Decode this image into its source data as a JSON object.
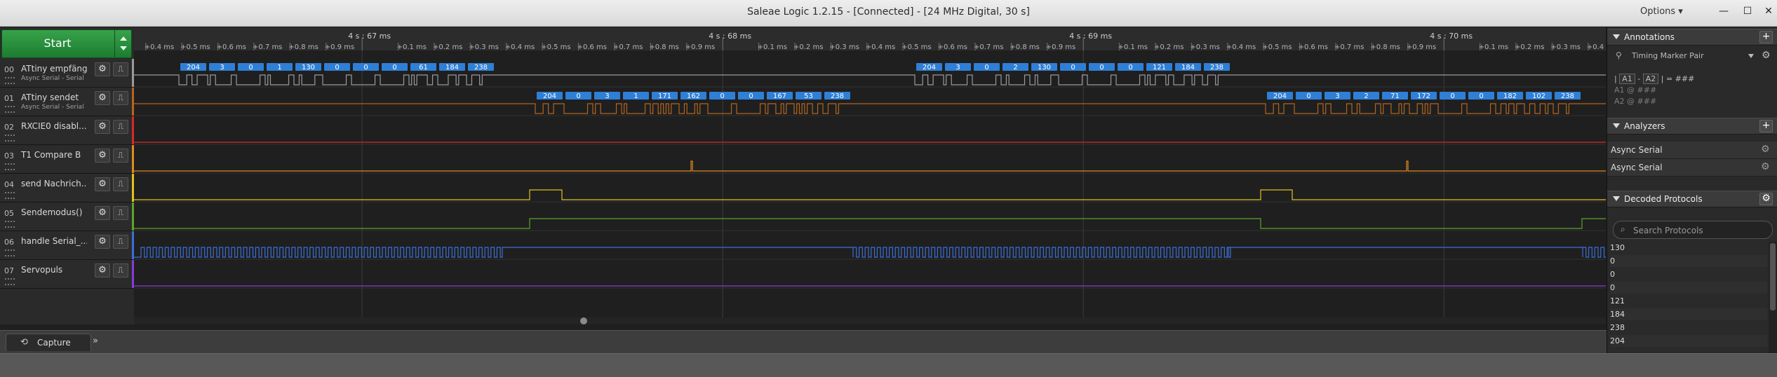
{
  "window": {
    "title": "Saleae Logic 1.2.15 - [Connected] - [24 MHz Digital, 30 s]",
    "options_label": "Options ▾",
    "minimize": "—",
    "maximize": "☐",
    "close": "✕"
  },
  "start_button": {
    "label": "Start"
  },
  "channels": [
    {
      "num": "00",
      "name": "ATtiny empfängt",
      "sub": "Async Serial - Serial",
      "color": "#9a9a9a"
    },
    {
      "num": "01",
      "name": "ATtiny sendet",
      "sub": "Async Serial - Serial",
      "color": "#b5651d"
    },
    {
      "num": "02",
      "name": "RXCIE0 disabl...",
      "sub": "",
      "color": "#d42a2a"
    },
    {
      "num": "03",
      "name": "T1 Compare B",
      "sub": "",
      "color": "#e08a1e"
    },
    {
      "num": "04",
      "name": "send Nachrich...",
      "sub": "",
      "color": "#e0c21e"
    },
    {
      "num": "05",
      "name": "Sendemodus()",
      "sub": "",
      "color": "#5aa52a"
    },
    {
      "num": "06",
      "name": "handle Serial_...",
      "sub": "",
      "color": "#3a6fd8"
    },
    {
      "num": "07",
      "name": "Servopuls",
      "sub": "",
      "color": "#8a3ad8"
    }
  ],
  "timeline": {
    "major_labels": [
      {
        "at": 0.155,
        "text": "4 s : 67 ms"
      },
      {
        "at": 0.4,
        "text": "4 s : 68 ms"
      },
      {
        "at": 0.645,
        "text": "4 s : 69 ms"
      },
      {
        "at": 0.89,
        "text": "4 s : 70 ms"
      }
    ],
    "ms_per_major": 1,
    "minor_labels": [
      "+0.1 ms",
      "+0.2 ms",
      "+0.3 ms",
      "+0.4 ms",
      "+0.5 ms",
      "+0.6 ms",
      "+0.7 ms",
      "+0.8 ms",
      "+0.9 ms"
    ]
  },
  "decoded_frames": {
    "ch00_burst1": [
      "204",
      "3",
      "0",
      "1",
      "130",
      "0",
      "0",
      "0",
      "61",
      "184",
      "238"
    ],
    "ch00_burst2": [
      "204",
      "3",
      "0",
      "2",
      "130",
      "0",
      "0",
      "0",
      "121",
      "184",
      "238"
    ],
    "ch01_burst1": [
      "204",
      "0",
      "3",
      "1",
      "171",
      "162",
      "0",
      "0",
      "167",
      "53",
      "238"
    ],
    "ch01_burst2": [
      "204",
      "0",
      "3",
      "2",
      "71",
      "172",
      "0",
      "0",
      "182",
      "102",
      "238"
    ]
  },
  "annotations_panel": {
    "title": "Annotations",
    "add": "+",
    "timing_marker_pair": "Timing Marker Pair",
    "line1_a1": "A1",
    "line1_a2": "A2",
    "line1_val": "= ###",
    "line2": "A1  @  ###",
    "line3": "A2  @  ###"
  },
  "analyzers_panel": {
    "title": "Analyzers",
    "add": "+",
    "items": [
      "Async Serial",
      "Async Serial"
    ]
  },
  "decoded_panel": {
    "title": "Decoded Protocols",
    "search_placeholder": "Search Protocols",
    "rows": [
      "130",
      "0",
      "0",
      "0",
      "121",
      "184",
      "238",
      "204"
    ]
  },
  "bottom": {
    "capture_tab": "Capture",
    "more": "»"
  },
  "colors": {
    "frame_fill": "#2f7fd6",
    "frame_text": "#ffffff",
    "wave_bg": "#1f1f1f",
    "row_line": "#323232"
  }
}
